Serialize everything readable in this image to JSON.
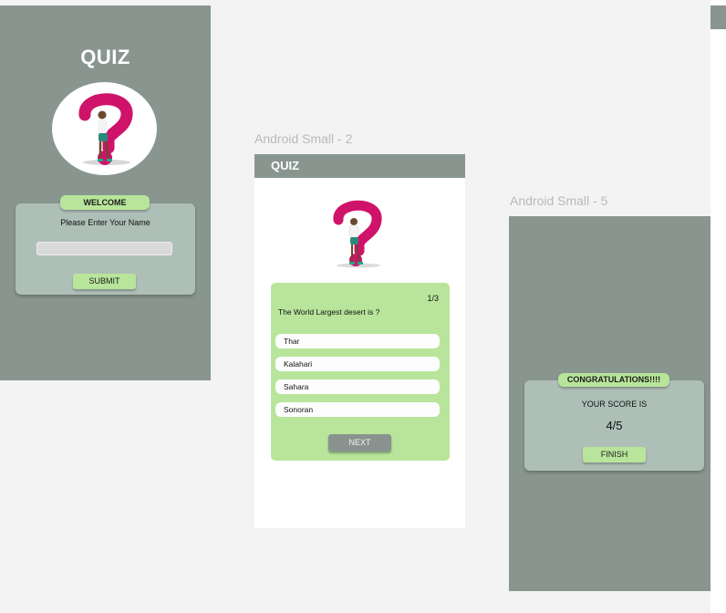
{
  "frames": {
    "frame2_label": "Android Small - 2",
    "frame5_label": "Android Small - 5"
  },
  "welcome_screen": {
    "title": "QUIZ",
    "welcome_badge": "WELCOME",
    "name_prompt": "Please Enter Your Name",
    "name_input_value": "",
    "submit_label": "SUBMIT"
  },
  "question_screen": {
    "header_title": "QUIZ",
    "counter": "1/3",
    "question": "The World Largest desert is ?",
    "options": [
      "Thar",
      "Kalahari",
      "Sahara",
      "Sonoran"
    ],
    "next_label": "NEXT"
  },
  "result_screen": {
    "badge": "CONGRATULATIONS!!!!",
    "score_label": "YOUR SCORE IS",
    "score": "4/5",
    "finish_label": "FINISH"
  },
  "colors": {
    "frame_bg": "#88968f",
    "card_bg": "#aebfb7",
    "accent_green": "#b8e59b",
    "question_mark": "#d0136a",
    "next_button": "#8a928f"
  },
  "icons": {
    "quiz_illustration": "question-mark-person-illustration"
  }
}
